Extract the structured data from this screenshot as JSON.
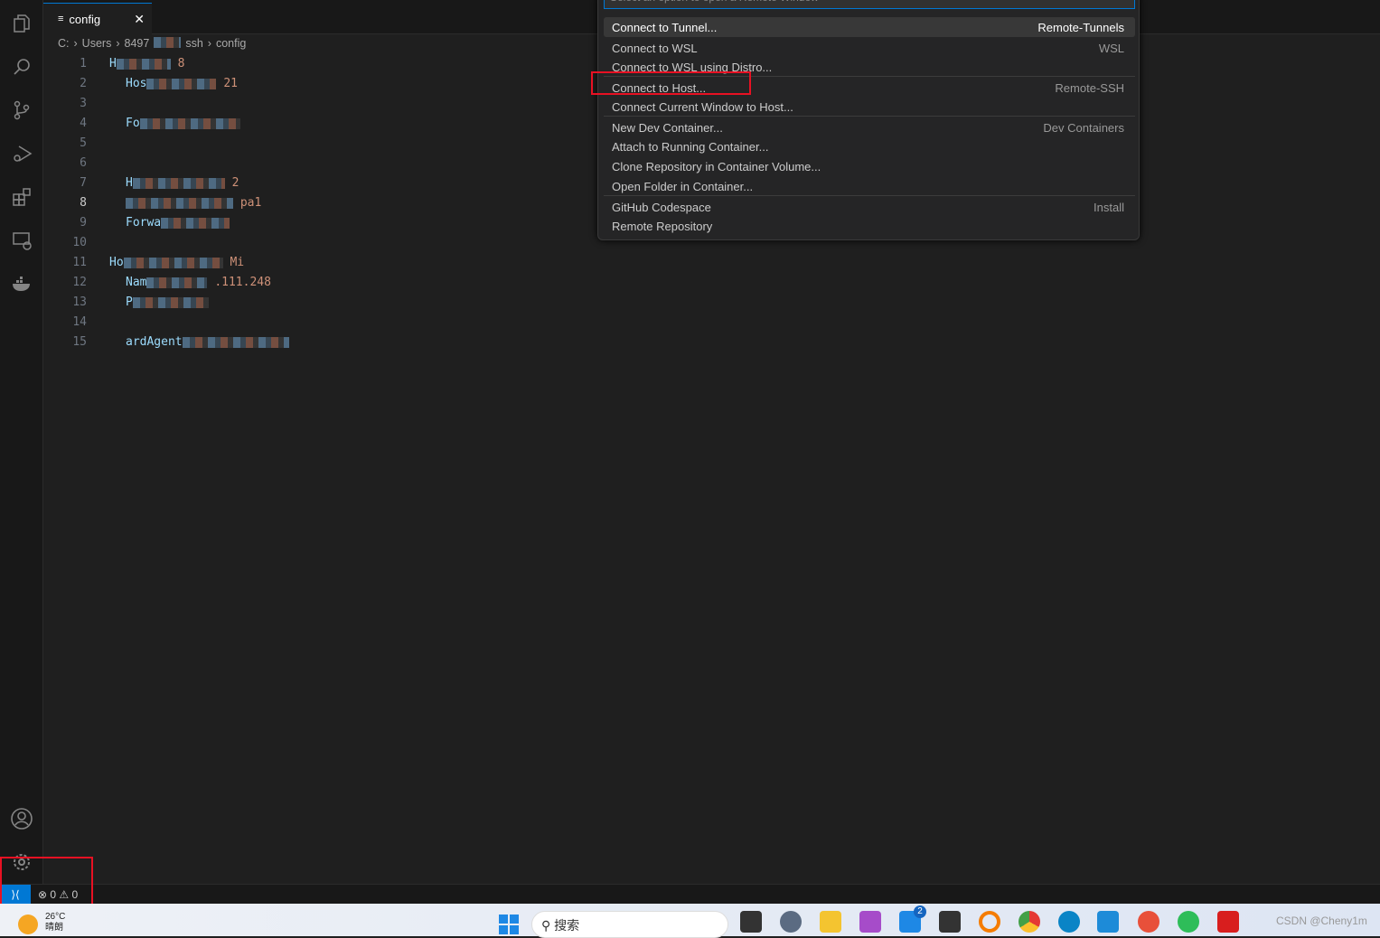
{
  "editor": {
    "tab": "config",
    "breadcrumb": [
      "C:",
      "Users",
      "8497",
      "ssh",
      "config"
    ],
    "lines": [
      {
        "n": "1",
        "kw": "H",
        "val": "8",
        "indent": 0
      },
      {
        "n": "2",
        "kw": "Hos",
        "val": "21",
        "indent": 1
      },
      {
        "n": "3",
        "kw": "",
        "val": "",
        "indent": 1
      },
      {
        "n": "4",
        "kw": "Fo",
        "val": "",
        "indent": 1
      },
      {
        "n": "5",
        "kw": "",
        "val": "",
        "indent": 0
      },
      {
        "n": "6",
        "kw": "",
        "val": "",
        "indent": 0
      },
      {
        "n": "7",
        "kw": "H",
        "val": "2",
        "indent": 1
      },
      {
        "n": "8",
        "kw": "",
        "val": "pa1",
        "indent": 1
      },
      {
        "n": "9",
        "kw": "Forwa",
        "val": "",
        "indent": 1
      },
      {
        "n": "10",
        "kw": "",
        "val": "",
        "indent": 0
      },
      {
        "n": "11",
        "kw": "Ho",
        "val": "Mi",
        "indent": 0
      },
      {
        "n": "12",
        "kw": "Nam",
        "val": ".111.248",
        "indent": 1
      },
      {
        "n": "13",
        "kw": "P",
        "val": "",
        "indent": 1
      },
      {
        "n": "14",
        "kw": "",
        "val": "",
        "indent": 1
      },
      {
        "n": "15",
        "kw": "ardAgent",
        "val": "",
        "indent": 1
      }
    ]
  },
  "quickpick": {
    "placeholder": "Select an option to open a Remote Window",
    "items": [
      {
        "label": "Connect to Tunnel...",
        "detail": "Remote-Tunnels",
        "selected": true
      },
      {
        "label": "Connect to WSL",
        "detail": "WSL"
      },
      {
        "label": "Connect to WSL using Distro...",
        "detail": ""
      },
      {
        "label": "Connect to Host...",
        "detail": "Remote-SSH"
      },
      {
        "label": "Connect Current Window to Host...",
        "detail": ""
      },
      {
        "label": "New Dev Container...",
        "detail": "Dev Containers"
      },
      {
        "label": "Attach to Running Container...",
        "detail": ""
      },
      {
        "label": "Clone Repository in Container Volume...",
        "detail": ""
      },
      {
        "label": "Open Folder in Container...",
        "detail": ""
      },
      {
        "label": "GitHub Codespace",
        "detail": "Install"
      },
      {
        "label": "Remote Repository",
        "detail": ""
      }
    ]
  },
  "status": {
    "errors": "0",
    "warnings": "0"
  },
  "taskbar": {
    "weather_temp": "26°C",
    "weather_desc": "晴朗",
    "search": "搜索",
    "mail_badge": "2",
    "watermark": "CSDN @Cheny1m"
  },
  "colors": {
    "accent": "#0078d4",
    "highlight": "#e81123"
  }
}
